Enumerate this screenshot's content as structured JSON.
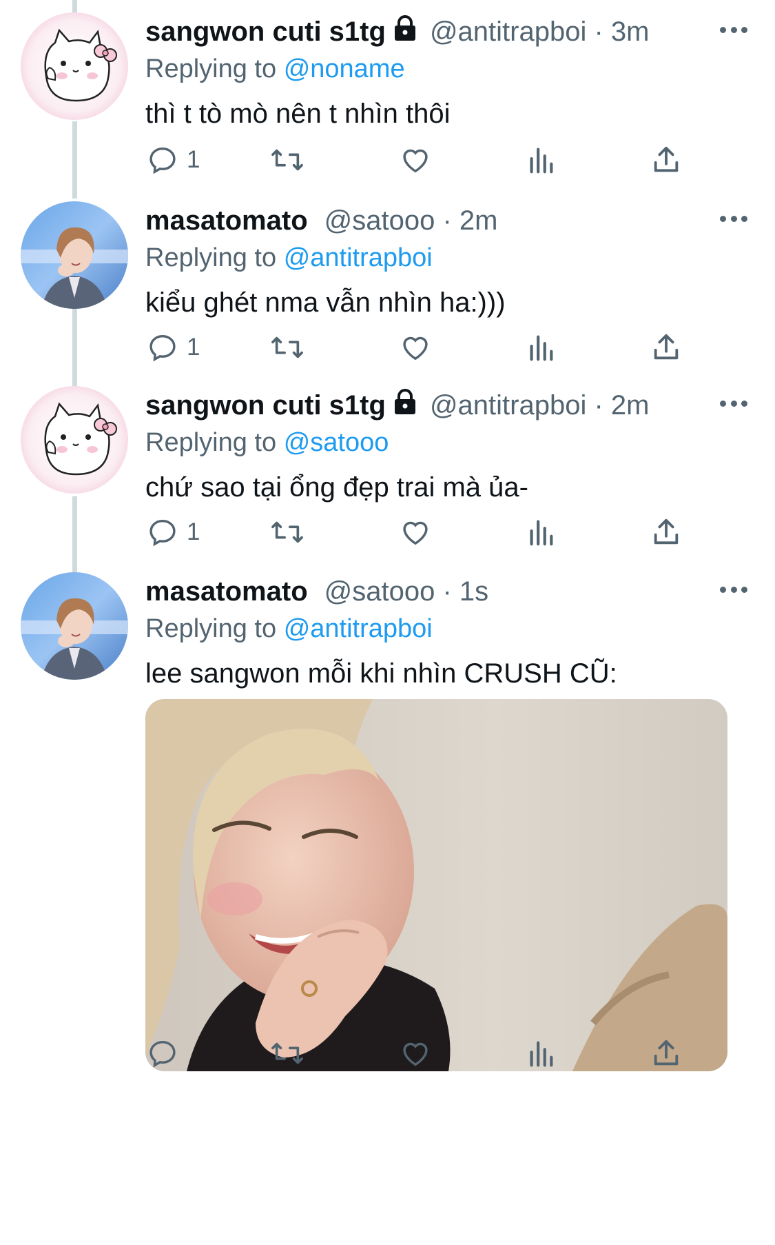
{
  "tweets": [
    {
      "name": "sangwon cuti s1tg",
      "locked": true,
      "handle_time": "@antitrapboi · 3m",
      "replying_label": "Replying to",
      "replying_to": "@noname",
      "text": "thì t tò mò nên t nhìn thôi",
      "reply_count": "1",
      "avatar": "cat-avatar"
    },
    {
      "name": "masatomato",
      "locked": false,
      "handle_time": "@satooo · 2m",
      "replying_label": "Replying to",
      "replying_to": "@antitrapboi",
      "text": "kiểu ghét nma vẫn nhìn ha:)))",
      "reply_count": "1",
      "avatar": "photo-avatar"
    },
    {
      "name": "sangwon cuti s1tg",
      "locked": true,
      "handle_time": "@antitrapboi · 2m",
      "replying_label": "Replying to",
      "replying_to": "@satooo",
      "text": "chứ sao tại ổng đẹp trai mà ủa-",
      "reply_count": "1",
      "avatar": "cat-avatar"
    },
    {
      "name": "masatomato",
      "locked": false,
      "handle_time": "@satooo · 1s",
      "replying_label": "Replying to",
      "replying_to": "@antitrapboi",
      "text": "lee sangwon mỗi khi nhìn CRUSH CŨ:",
      "reply_count": "",
      "avatar": "photo-avatar",
      "has_media": true
    }
  ],
  "icons": {
    "reply": "reply-icon",
    "retweet": "retweet-icon",
    "like": "heart-icon",
    "views": "analytics-icon",
    "share": "share-icon",
    "more": "more-icon",
    "lock": "lock-icon"
  },
  "colors": {
    "link": "#1d9bf0",
    "secondary": "#536471",
    "thread_line": "#cfd9de"
  }
}
